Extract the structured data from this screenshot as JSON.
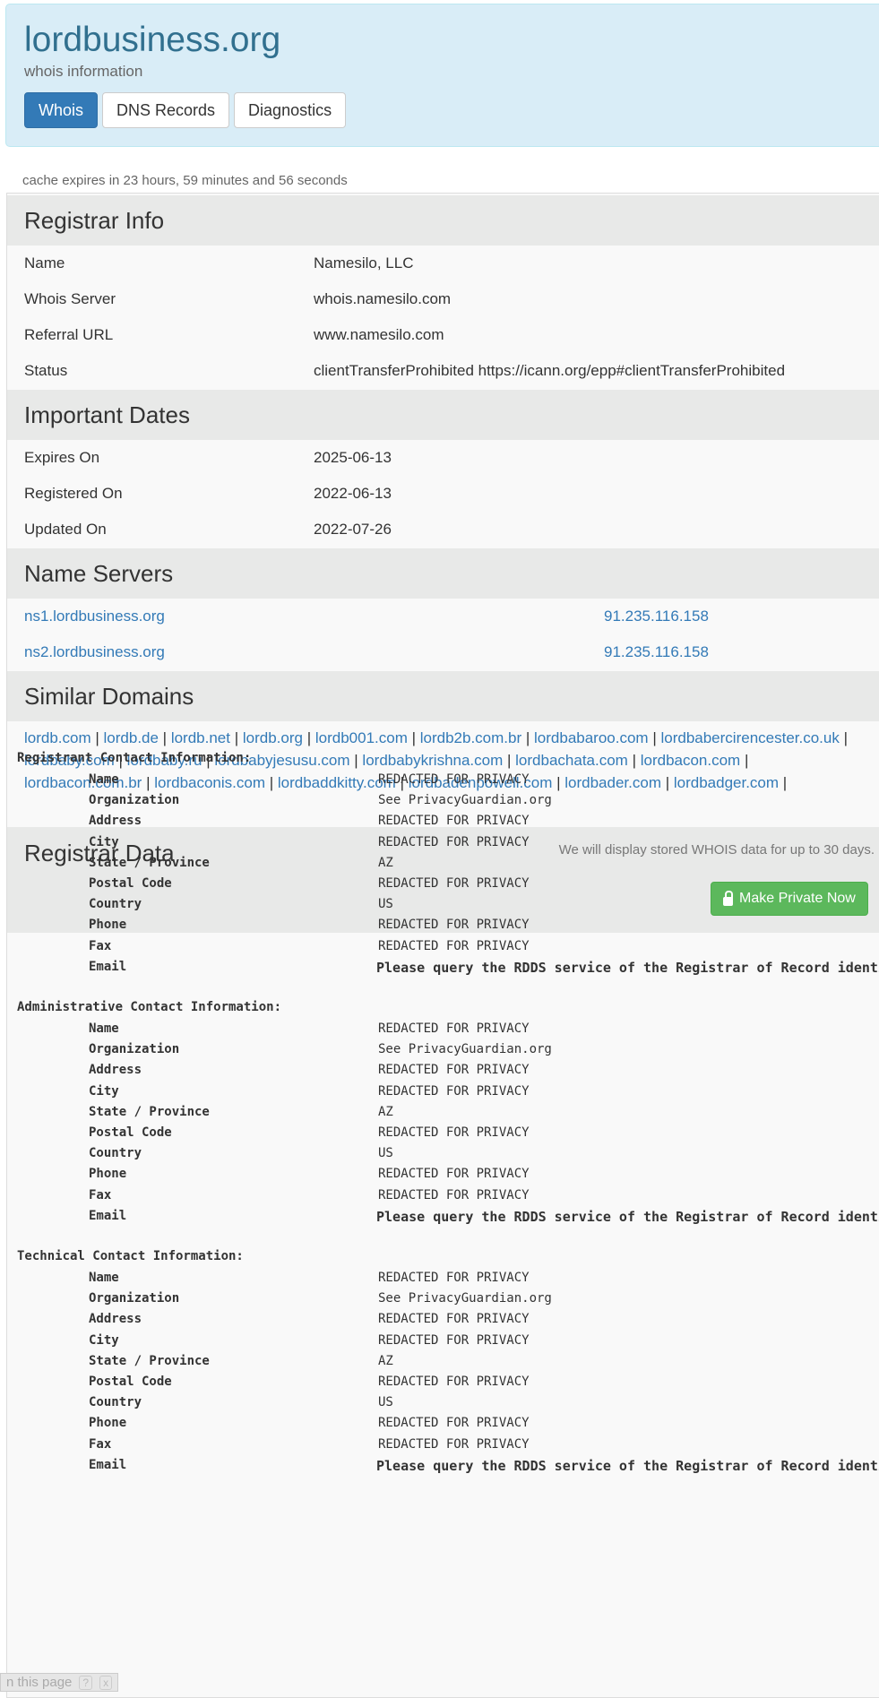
{
  "header": {
    "title": "lordbusiness.org",
    "subtitle": "whois information",
    "tabs": [
      "Whois",
      "DNS Records",
      "Diagnostics"
    ]
  },
  "cache_text": "cache expires in 23 hours, 59 minutes and 56 seconds",
  "registrar_info": {
    "heading": "Registrar Info",
    "rows": [
      {
        "k": "Name",
        "v": "Namesilo, LLC"
      },
      {
        "k": "Whois Server",
        "v": "whois.namesilo.com"
      },
      {
        "k": "Referral URL",
        "v": "www.namesilo.com"
      },
      {
        "k": "Status",
        "v": "clientTransferProhibited https://icann.org/epp#clientTransferProhibited"
      }
    ]
  },
  "important_dates": {
    "heading": "Important Dates",
    "rows": [
      {
        "k": "Expires On",
        "v": "2025-06-13"
      },
      {
        "k": "Registered On",
        "v": "2022-06-13"
      },
      {
        "k": "Updated On",
        "v": "2022-07-26"
      }
    ]
  },
  "name_servers": {
    "heading": "Name Servers",
    "rows": [
      {
        "host": "ns1.lordbusiness.org",
        "ip": "91.235.116.158"
      },
      {
        "host": "ns2.lordbusiness.org",
        "ip": "91.235.116.158"
      }
    ]
  },
  "similar_domains": {
    "heading": "Similar Domains",
    "domains": [
      "lordb.com",
      "lordb.de",
      "lordb.net",
      "lordb.org",
      "lordb001.com",
      "lordb2b.com.br",
      "lordbabaroo.com",
      "lordbabercirencester.co.uk",
      "lordbaby.com",
      "lordbaby.ru",
      "lordbabyjesusu.com",
      "lordbabykrishna.com",
      "lordbachata.com",
      "lordbacon.com",
      "lordbacon.com.br",
      "lordbaconis.com",
      "lordbaddkitty.com",
      "lordbadenpowell.com",
      "lordbader.com",
      "lordbadger.com"
    ]
  },
  "registrar_data": {
    "heading": "Registrar Data",
    "note": "We will display stored WHOIS data for up to 30 days.",
    "button": "Make Private Now",
    "blocks": [
      {
        "title": "Registrant Contact Information:",
        "rows": [
          {
            "k": "Name",
            "v": "REDACTED FOR PRIVACY"
          },
          {
            "k": "Organization",
            "v": "See PrivacyGuardian.org"
          },
          {
            "k": "Address",
            "v": "REDACTED FOR PRIVACY"
          },
          {
            "k": "City",
            "v": "REDACTED FOR PRIVACY"
          },
          {
            "k": "State / Province",
            "v": "AZ"
          },
          {
            "k": "Postal Code",
            "v": "REDACTED FOR PRIVACY"
          },
          {
            "k": "Country",
            "v": "US"
          },
          {
            "k": "Phone",
            "v": "REDACTED FOR PRIVACY"
          },
          {
            "k": "Fax",
            "v": "REDACTED FOR PRIVACY"
          },
          {
            "k": "Email",
            "v": "Please query the RDDS service of the Registrar of Record identi"
          }
        ]
      },
      {
        "title": "Administrative Contact Information:",
        "rows": [
          {
            "k": "Name",
            "v": "REDACTED FOR PRIVACY"
          },
          {
            "k": "Organization",
            "v": "See PrivacyGuardian.org"
          },
          {
            "k": "Address",
            "v": "REDACTED FOR PRIVACY"
          },
          {
            "k": "City",
            "v": "REDACTED FOR PRIVACY"
          },
          {
            "k": "State / Province",
            "v": "AZ"
          },
          {
            "k": "Postal Code",
            "v": "REDACTED FOR PRIVACY"
          },
          {
            "k": "Country",
            "v": "US"
          },
          {
            "k": "Phone",
            "v": "REDACTED FOR PRIVACY"
          },
          {
            "k": "Fax",
            "v": "REDACTED FOR PRIVACY"
          },
          {
            "k": "Email",
            "v": "Please query the RDDS service of the Registrar of Record identi"
          }
        ]
      },
      {
        "title": "Technical Contact Information:",
        "rows": [
          {
            "k": "Name",
            "v": "REDACTED FOR PRIVACY"
          },
          {
            "k": "Organization",
            "v": "See PrivacyGuardian.org"
          },
          {
            "k": "Address",
            "v": "REDACTED FOR PRIVACY"
          },
          {
            "k": "City",
            "v": "REDACTED FOR PRIVACY"
          },
          {
            "k": "State / Province",
            "v": "AZ"
          },
          {
            "k": "Postal Code",
            "v": "REDACTED FOR PRIVACY"
          },
          {
            "k": "Country",
            "v": "US"
          },
          {
            "k": "Phone",
            "v": "REDACTED FOR PRIVACY"
          },
          {
            "k": "Fax",
            "v": "REDACTED FOR PRIVACY"
          },
          {
            "k": "Email",
            "v": "Please query the RDDS service of the Registrar of Record identi"
          }
        ]
      }
    ]
  },
  "footer_pill": {
    "label": "n this page",
    "icons": [
      "?",
      "x"
    ]
  }
}
